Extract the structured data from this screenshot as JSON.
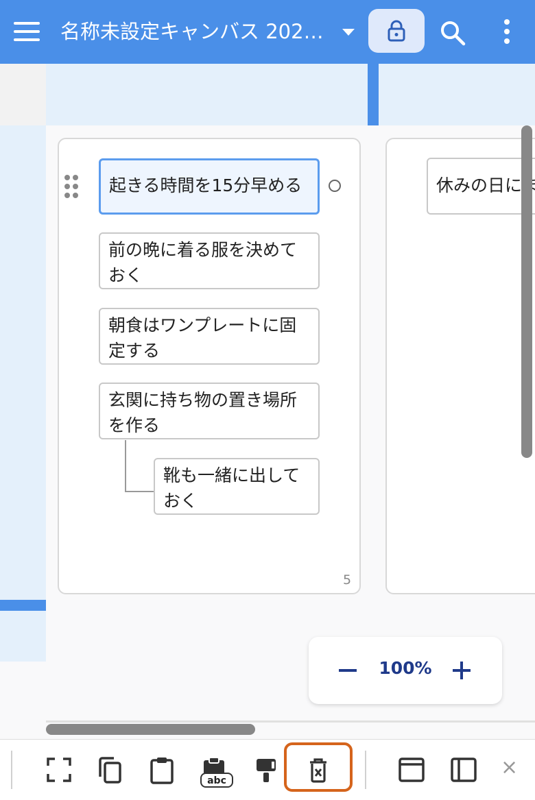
{
  "header": {
    "title": "名称未設定キャンバス 202…",
    "colors": {
      "bar": "#4a8fe8",
      "lock_bg": "#dfe9fb"
    }
  },
  "canvas": {
    "cards": [
      {
        "items": [
          {
            "text": "起きる時間を15分早める",
            "selected": true
          },
          {
            "text": "前の晩に着る服を決めておく"
          },
          {
            "text": "朝食はワンプレートに固定する"
          },
          {
            "text": "玄関に持ち物の置き場所を作る"
          },
          {
            "text": "靴も一緒に出しておく",
            "child": true
          }
        ],
        "count": "5"
      },
      {
        "items": [
          {
            "text": "休みの日にま"
          }
        ]
      }
    ],
    "zoom": {
      "level": "100%"
    }
  },
  "toolbar": {
    "clipboard_label": "abc",
    "close_label": "×",
    "highlight_color": "#d5641c"
  }
}
